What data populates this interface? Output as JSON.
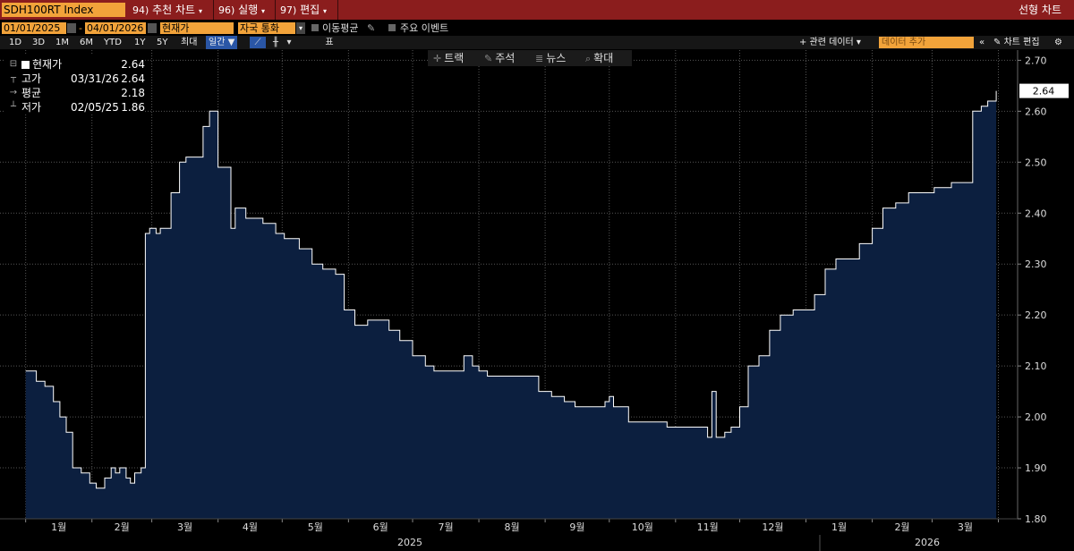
{
  "toolbar": {
    "ticker": "SDH100RT Index",
    "menus": [
      {
        "num": "94)",
        "label": "추천 차트"
      },
      {
        "num": "96)",
        "label": "실행"
      },
      {
        "num": "97)",
        "label": "편집"
      }
    ],
    "chart_type": "선형 차트"
  },
  "controls": {
    "start_date": "01/01/2025",
    "end_date": "04/01/2026",
    "price_field": "현재가",
    "currency": "자국 통화",
    "moving_avg_label": "이동평균",
    "key_events_label": "주요 이벤트"
  },
  "periods": [
    "1D",
    "3D",
    "1M",
    "6M",
    "YTD",
    "1Y",
    "5Y",
    "최대"
  ],
  "frequency": "일간",
  "table_label": "표",
  "related_data": "+ 관련 데이터",
  "search_placeholder": "데이터 추가",
  "edit_chart": "차트 편집",
  "tools": [
    "트랙",
    "주석",
    "뉴스",
    "확대"
  ],
  "legend": {
    "current": {
      "label": "현재가",
      "value": "2.64"
    },
    "high": {
      "label": "고가",
      "date": "03/31/26",
      "value": "2.64"
    },
    "average": {
      "label": "평균",
      "value": "2.18"
    },
    "low": {
      "label": "저가",
      "date": "02/05/25",
      "value": "1.86"
    }
  },
  "last_price_label": "2.64",
  "colors": {
    "line": "#ffffff",
    "fill": "#0c1f3f",
    "accent": "#f2a33a",
    "toolbar": "#8b1d1d"
  },
  "chart_data": {
    "type": "area",
    "title": "",
    "xlabel": "",
    "ylabel": "",
    "x_ticks": [
      "1월",
      "2월",
      "3월",
      "4월",
      "5월",
      "6월",
      "7월",
      "8월",
      "9월",
      "10월",
      "11월",
      "12월",
      "1월",
      "2월",
      "3월"
    ],
    "years": [
      "2025",
      "2026"
    ],
    "y_ticks": [
      "1.80",
      "1.90",
      "2.00",
      "2.10",
      "2.20",
      "2.30",
      "2.40",
      "2.50",
      "2.60",
      "2.70"
    ],
    "ylim": [
      1.8,
      2.72
    ],
    "grid": true,
    "series": [
      {
        "x": [
          "2025-01-01",
          "2025-01-03",
          "2025-01-06",
          "2025-01-10",
          "2025-01-14",
          "2025-01-17",
          "2025-01-20",
          "2025-01-23",
          "2025-01-27",
          "2025-01-31",
          "2025-02-03",
          "2025-02-05",
          "2025-02-07",
          "2025-02-10",
          "2025-02-12",
          "2025-02-14",
          "2025-02-17",
          "2025-02-19",
          "2025-02-21",
          "2025-02-24",
          "2025-02-26",
          "2025-02-28",
          "2025-03-03",
          "2025-03-05",
          "2025-03-07",
          "2025-03-10",
          "2025-03-12",
          "2025-03-14",
          "2025-03-17",
          "2025-03-21",
          "2025-03-25",
          "2025-03-28",
          "2025-04-01",
          "2025-04-03",
          "2025-04-07",
          "2025-04-09",
          "2025-04-14",
          "2025-04-17",
          "2025-04-22",
          "2025-04-28",
          "2025-05-02",
          "2025-05-09",
          "2025-05-15",
          "2025-05-20",
          "2025-05-26",
          "2025-05-30",
          "2025-06-04",
          "2025-06-10",
          "2025-06-16",
          "2025-06-20",
          "2025-06-25",
          "2025-07-01",
          "2025-07-07",
          "2025-07-11",
          "2025-07-15",
          "2025-07-21",
          "2025-07-25",
          "2025-07-29",
          "2025-08-01",
          "2025-08-05",
          "2025-08-11",
          "2025-08-18",
          "2025-08-25",
          "2025-08-29",
          "2025-09-04",
          "2025-09-10",
          "2025-09-15",
          "2025-09-22",
          "2025-09-29",
          "2025-10-01",
          "2025-10-03",
          "2025-10-10",
          "2025-10-16",
          "2025-10-22",
          "2025-10-28",
          "2025-11-03",
          "2025-11-10",
          "2025-11-14",
          "2025-11-16",
          "2025-11-18",
          "2025-11-20",
          "2025-11-24",
          "2025-11-27",
          "2025-12-01",
          "2025-12-05",
          "2025-12-10",
          "2025-12-15",
          "2025-12-20",
          "2025-12-26",
          "2026-01-05",
          "2026-01-10",
          "2026-01-15",
          "2026-01-20",
          "2026-01-26",
          "2026-02-01",
          "2026-02-06",
          "2026-02-12",
          "2026-02-18",
          "2026-02-24",
          "2026-03-02",
          "2026-03-06",
          "2026-03-10",
          "2026-03-13",
          "2026-03-17",
          "2026-03-20",
          "2026-03-24",
          "2026-03-27",
          "2026-03-31"
        ],
        "values": [
          2.09,
          2.09,
          2.07,
          2.06,
          2.03,
          2.0,
          1.97,
          1.9,
          1.89,
          1.87,
          1.86,
          1.86,
          1.88,
          1.9,
          1.89,
          1.9,
          1.88,
          1.87,
          1.89,
          1.9,
          2.36,
          2.37,
          2.36,
          2.37,
          2.37,
          2.44,
          2.44,
          2.5,
          2.51,
          2.51,
          2.57,
          2.6,
          2.49,
          2.49,
          2.37,
          2.41,
          2.39,
          2.39,
          2.38,
          2.36,
          2.35,
          2.33,
          2.3,
          2.29,
          2.28,
          2.21,
          2.18,
          2.19,
          2.19,
          2.17,
          2.15,
          2.12,
          2.1,
          2.09,
          2.09,
          2.09,
          2.12,
          2.1,
          2.09,
          2.08,
          2.08,
          2.08,
          2.08,
          2.05,
          2.04,
          2.03,
          2.02,
          2.02,
          2.03,
          2.04,
          2.02,
          1.99,
          1.99,
          1.99,
          1.98,
          1.98,
          1.98,
          1.98,
          1.96,
          2.05,
          1.96,
          1.97,
          1.98,
          2.02,
          2.1,
          2.12,
          2.17,
          2.2,
          2.21,
          2.24,
          2.29,
          2.31,
          2.31,
          2.34,
          2.37,
          2.41,
          2.42,
          2.44,
          2.44,
          2.45,
          2.45,
          2.46,
          2.46,
          2.46,
          2.6,
          2.61,
          2.62,
          2.64
        ]
      }
    ]
  }
}
